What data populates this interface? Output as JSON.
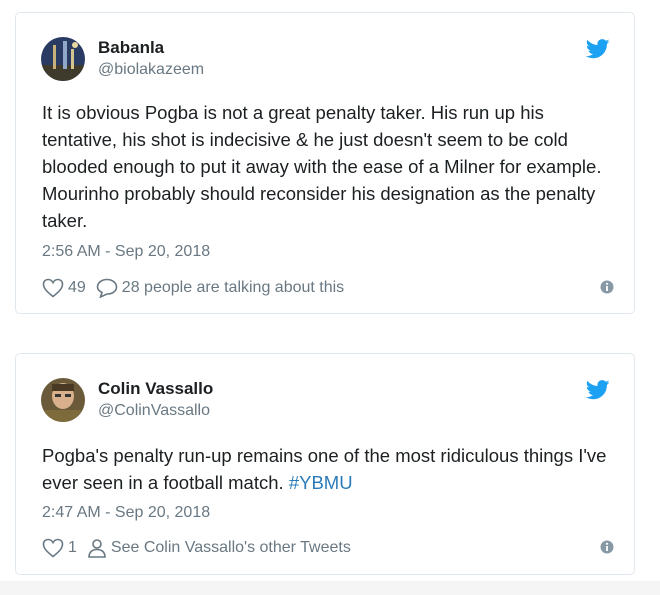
{
  "tweets": [
    {
      "author_name": "Babanla",
      "handle": "@biolakazeem",
      "text": "It is obvious Pogba is not a great penalty taker. His run up his tentative, his shot is indecisive & he just doesn't seem to be cold blooded enough to put it away with the ease of a Milner for example. Mourinho probably should reconsider his designation as the penalty taker.",
      "timestamp": "2:56 AM - Sep 20, 2018",
      "likes": "49",
      "talking": "28 people are talking about this"
    },
    {
      "author_name": "Colin Vassallo",
      "handle": "@ColinVassallo",
      "text_main": "Pogba's penalty run-up remains one of the most ridiculous things I've ever seen in a football match. ",
      "hashtag": "#YBMU",
      "timestamp": "2:47 AM - Sep 20, 2018",
      "likes": "1",
      "other_tweets": "See Colin Vassallo's other Tweets"
    }
  ],
  "colors": {
    "twitter_blue": "#1da1f2",
    "secondary_text": "#697882",
    "hashtag": "#2b7bb9",
    "border": "#e1e8ed"
  },
  "icons": [
    "twitter-bird-icon",
    "heart-icon",
    "comment-icon",
    "person-icon",
    "info-icon"
  ]
}
